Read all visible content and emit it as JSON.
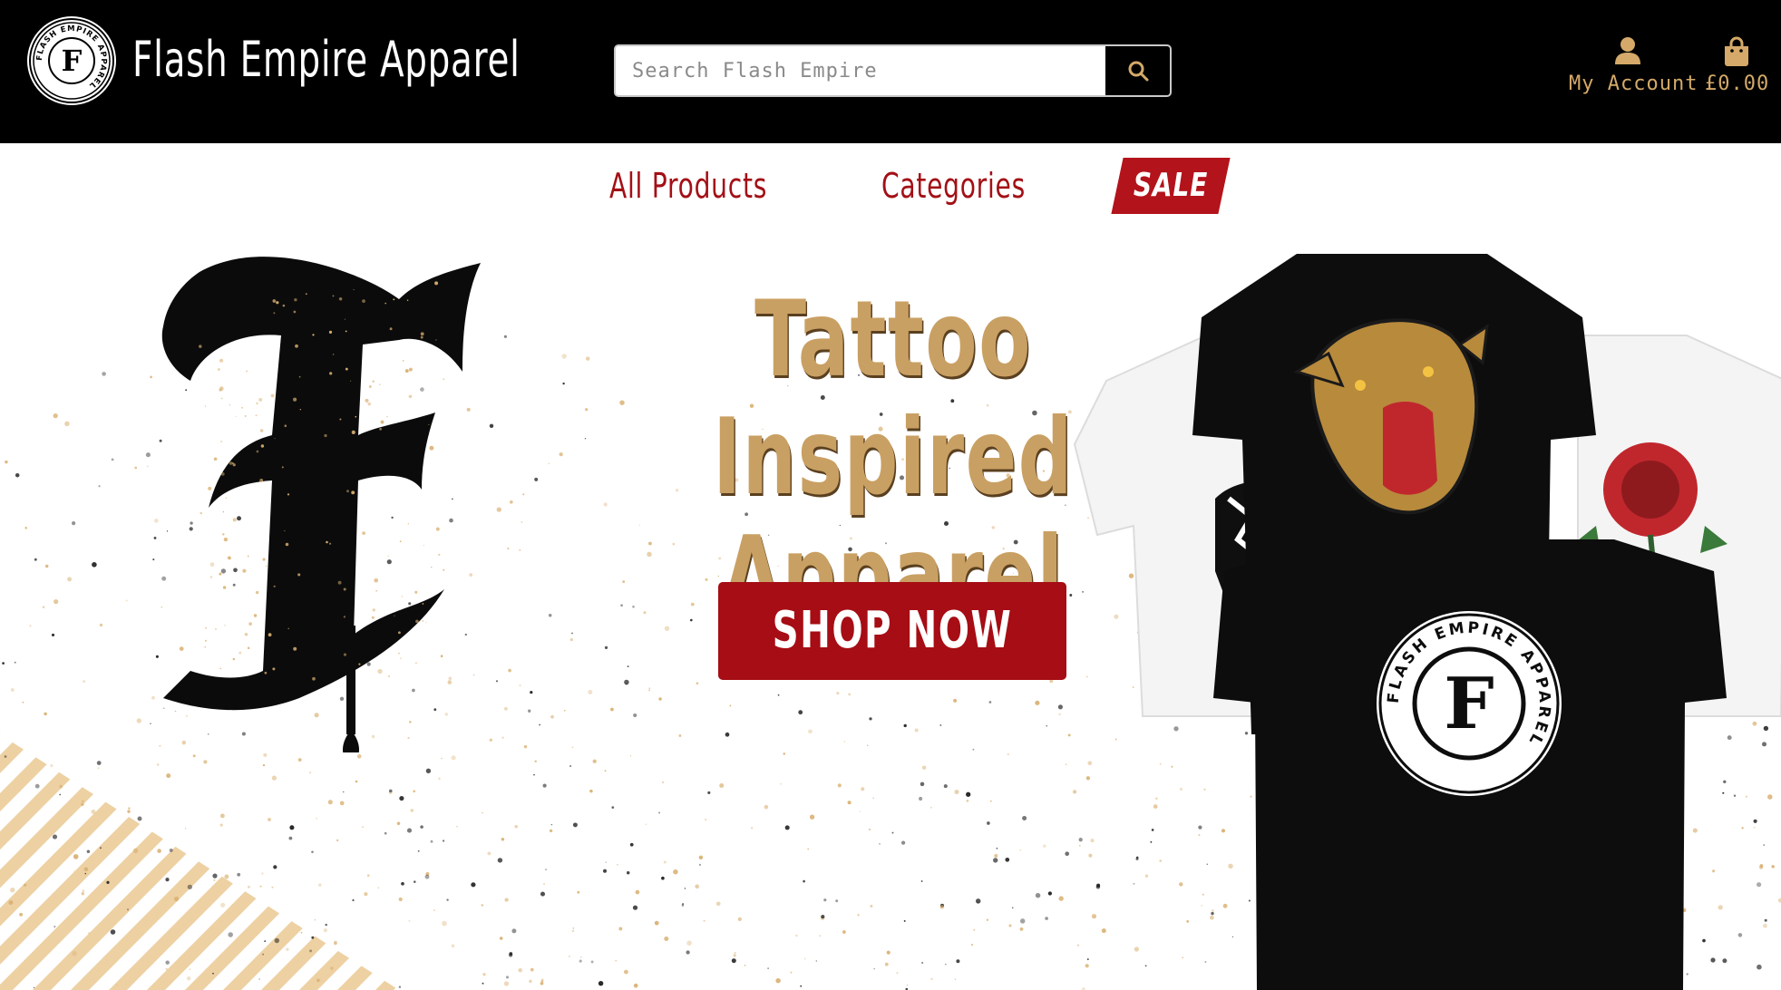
{
  "header": {
    "brand_name": "Flash Empire Apparel",
    "logo_text_top": "FLASH EMPIRE APPAREL",
    "logo_letter": "F",
    "search": {
      "placeholder": "Search Flash Empire",
      "value": ""
    },
    "account_label": "My Account",
    "cart_total": "£0.00"
  },
  "nav": {
    "items": [
      {
        "label": "All Products"
      },
      {
        "label": "Categories"
      },
      {
        "label": "SALE"
      }
    ]
  },
  "hero": {
    "title_line1": "Tattoo Inspired",
    "title_line2": "Apparel",
    "cta_label": "SHOP NOW",
    "big_letter": "F",
    "shirt_badge_text": "FLASH EMPIRE APPAREL",
    "shirt_badge_letter": "F"
  },
  "colors": {
    "header_bg": "#000000",
    "accent_gold": "#d4a969",
    "hero_gold": "#c9a063",
    "brand_red": "#a60d14",
    "sale_red": "#b3131b"
  },
  "icons": [
    "logo-badge",
    "search-icon",
    "user-icon",
    "shopping-bag-icon"
  ]
}
